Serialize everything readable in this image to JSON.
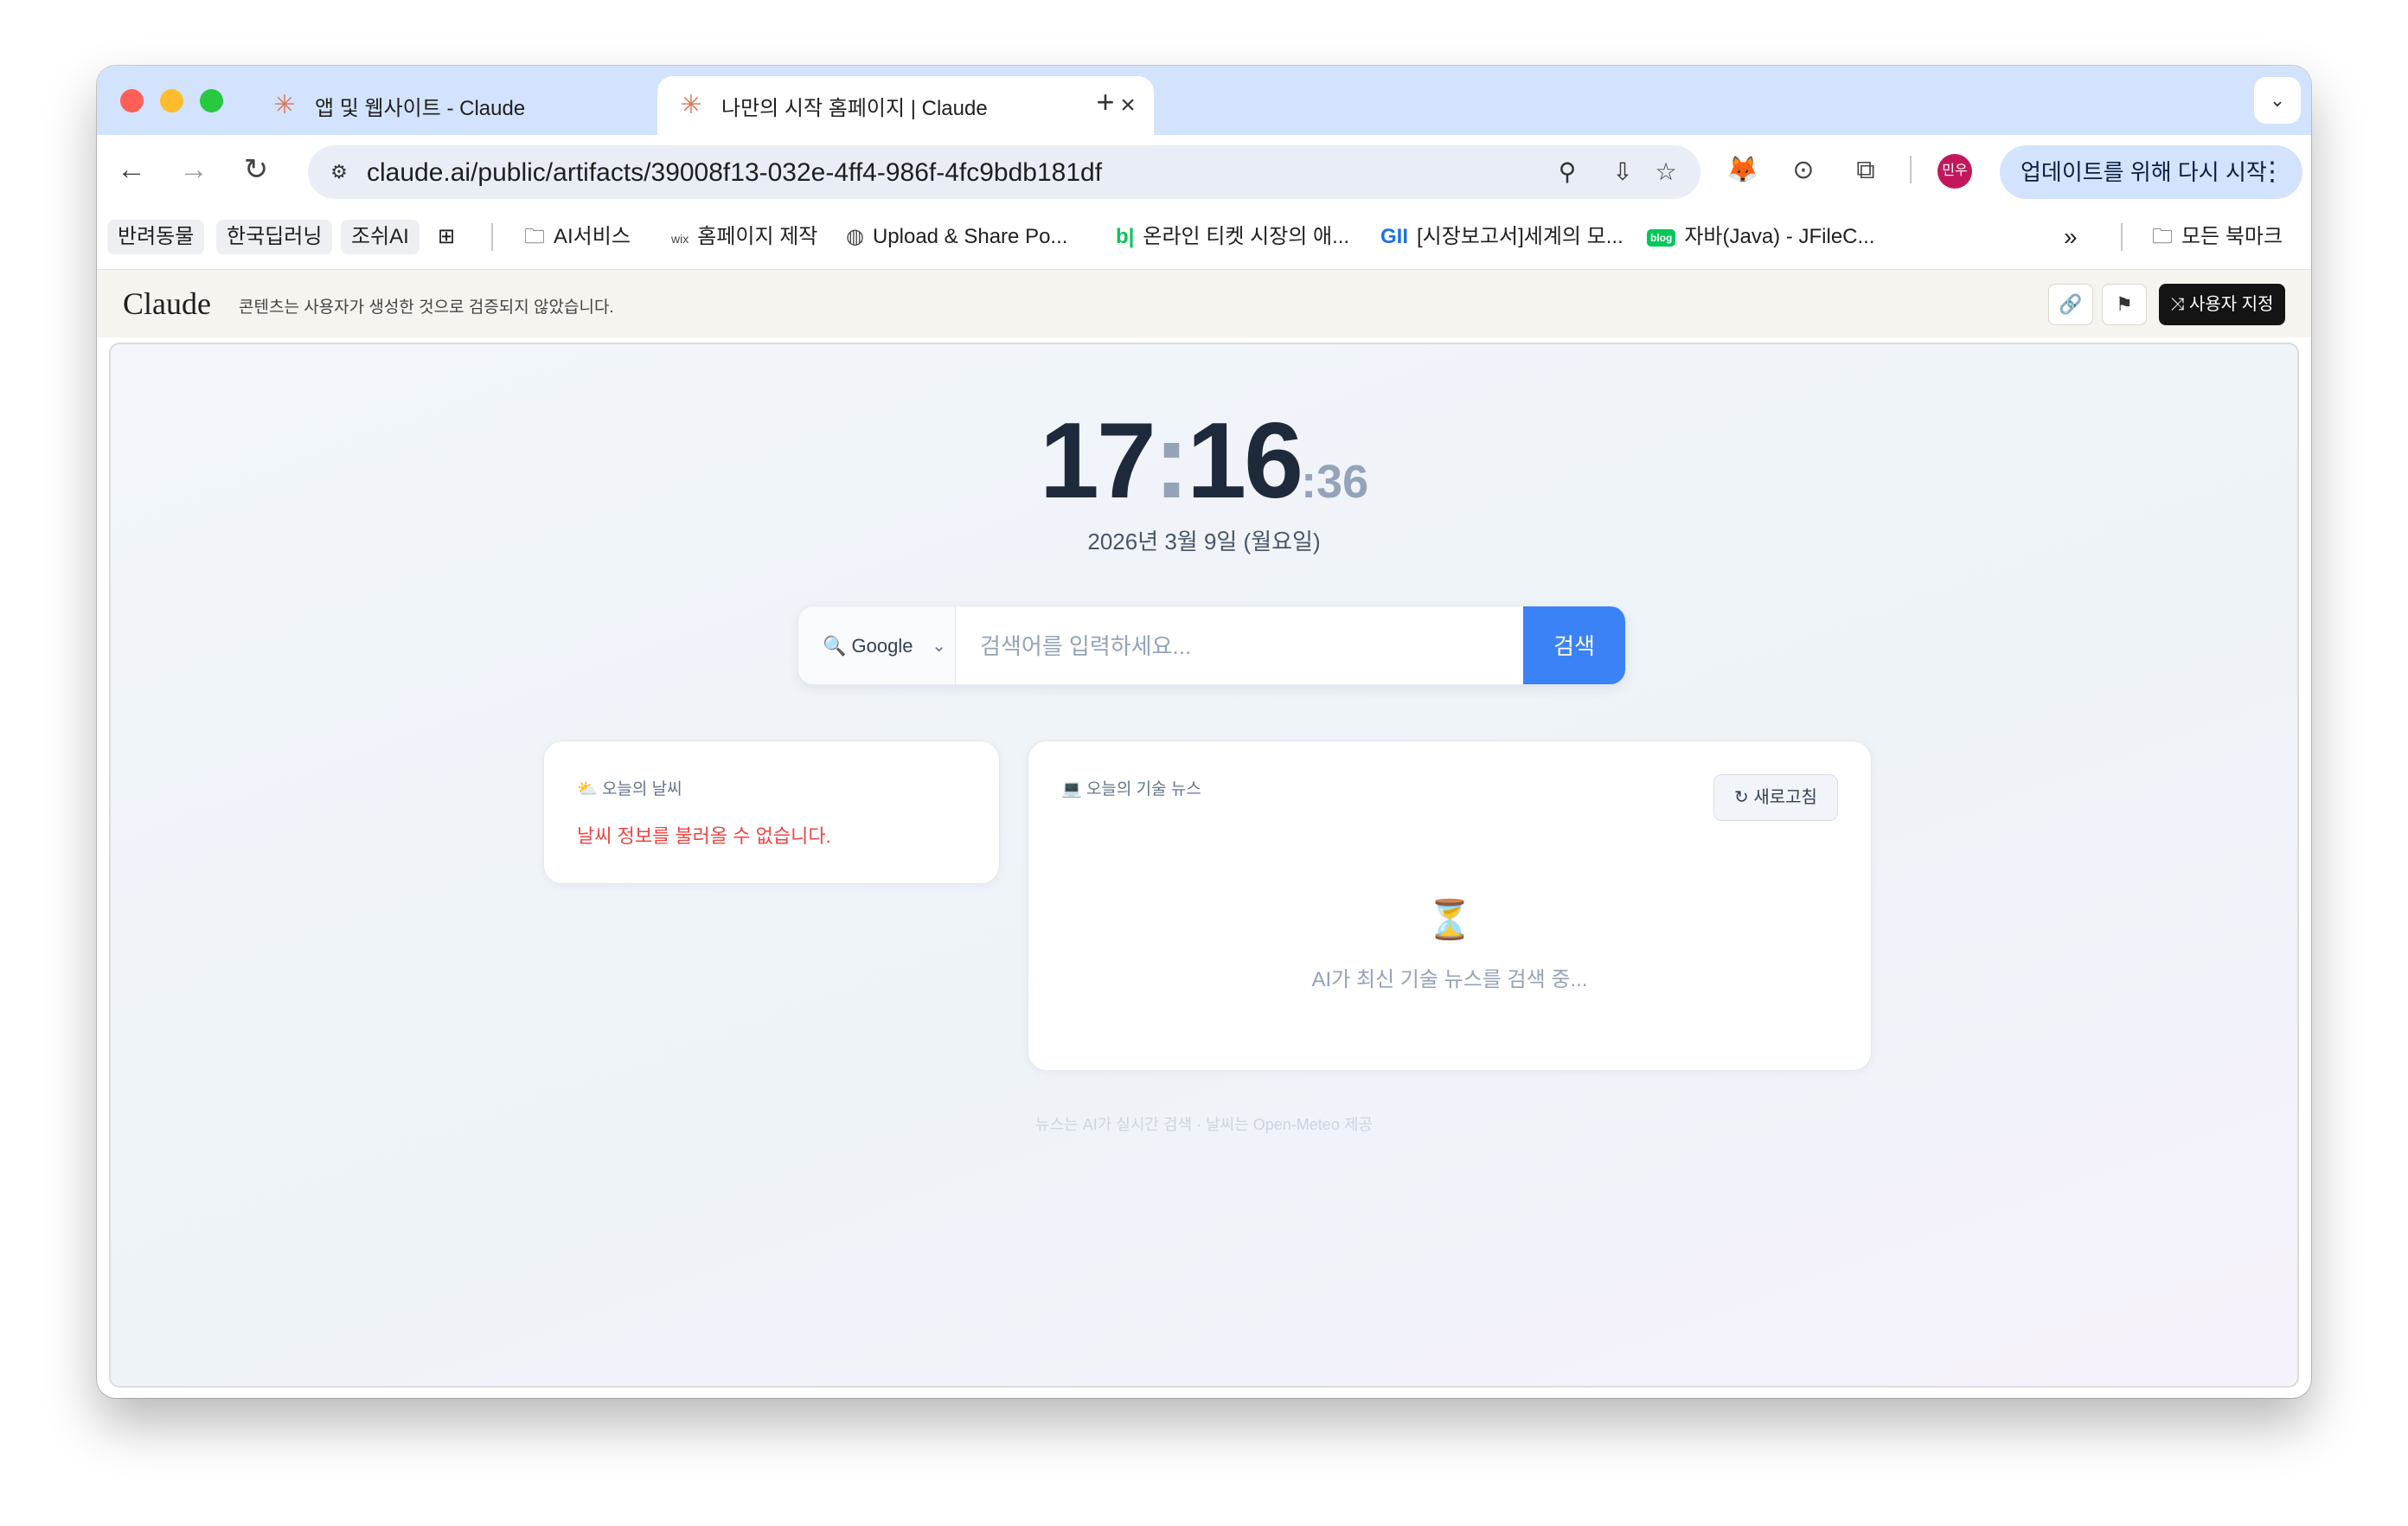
{
  "browser": {
    "tabs": [
      {
        "title": "앱 및 웹사이트 - Claude",
        "active": false
      },
      {
        "title": "나만의 시작 홈페이지 | Claude",
        "active": true
      }
    ],
    "new_tab_label": "+",
    "url": "claude.ai/public/artifacts/39008f13-032e-4ff4-986f-4fc9bdb181df",
    "profile_initials": "민우",
    "update_button": "업데이트를 위해 다시 시작"
  },
  "bookmarks": [
    {
      "label": "반려동물",
      "chip": true
    },
    {
      "label": "한국딥러닝",
      "chip": true
    },
    {
      "label": "조쉬AI",
      "chip": true
    },
    {
      "label": "AI서비스",
      "icon": "folder-icon"
    },
    {
      "label": "홈페이지 제작",
      "icon": "wix-icon",
      "icon_text": "wix"
    },
    {
      "label": "Upload & Share Po...",
      "icon": "globe-icon"
    },
    {
      "label": "온라인 티켓 시장의 애...",
      "icon": "bl-icon",
      "icon_text": "b|"
    },
    {
      "label": "[시장보고서]세계의 모...",
      "icon": "gii-icon",
      "icon_text": "GII"
    },
    {
      "label": "자바(Java) - JFileC...",
      "icon": "blog-icon",
      "icon_text": "blog"
    },
    {
      "label": "모든 북마크",
      "icon": "folder-icon"
    }
  ],
  "claude_header": {
    "logo": "Claude",
    "notice": "콘텐츠는 사용자가 생성한 것으로 검증되지 않았습니다.",
    "customize_button": "사용자 지정"
  },
  "clock": {
    "hours": "17",
    "minutes": "16",
    "seconds": ":36",
    "date": "2026년 3월 9일 (월요일)"
  },
  "search": {
    "engine": "Google",
    "placeholder": "검색어를 입력하세요...",
    "button": "검색"
  },
  "weather_card": {
    "title": "오늘의 날씨",
    "error": "날씨 정보를 불러올 수 없습니다."
  },
  "news_card": {
    "title": "오늘의 기술 뉴스",
    "refresh": "새로고침",
    "loading": "AI가 최신 기술 뉴스를 검색 중..."
  },
  "footer": "뉴스는 AI가 실시간 검색 · 날씨는 Open-Meteo 제공",
  "colors": {
    "accent": "#3b82f6",
    "error": "#ef4444",
    "clock": "#1e293b",
    "tab_strip": "#d3e3fd"
  }
}
